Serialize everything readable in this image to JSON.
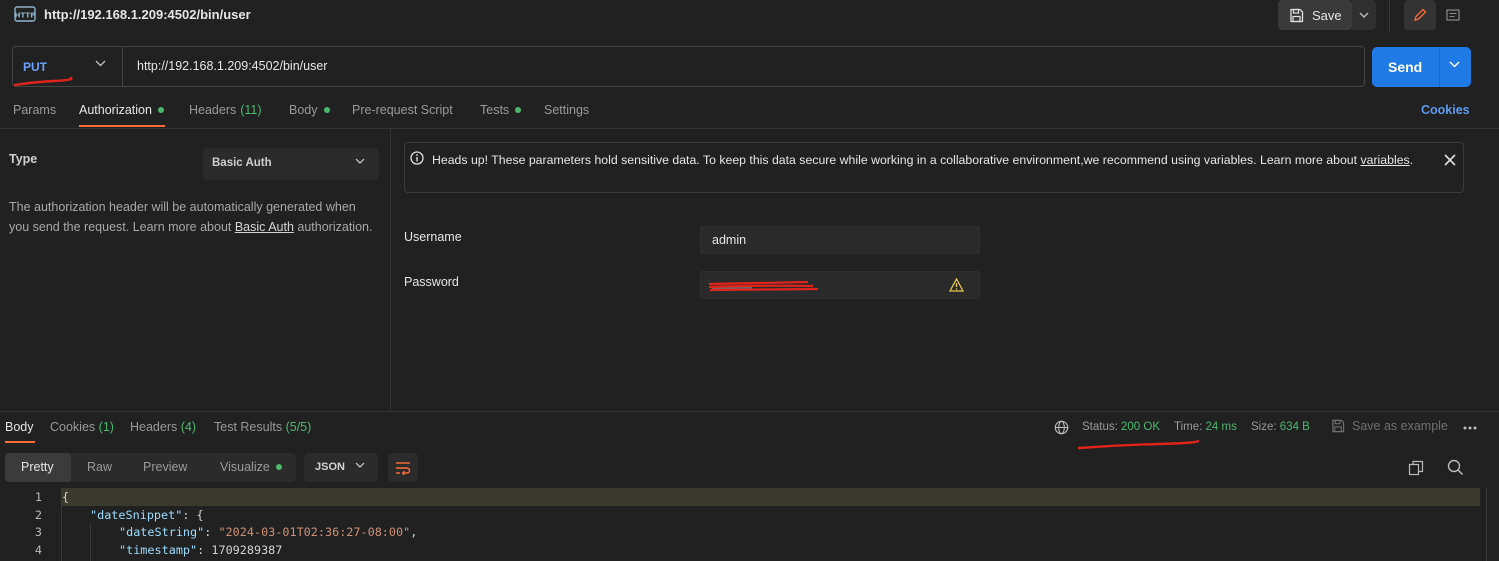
{
  "header": {
    "icon": "http-request-icon",
    "title": "http://192.168.1.209:4502/bin/user",
    "save_label": "Save"
  },
  "request": {
    "method": "PUT",
    "url": "http://192.168.1.209:4502/bin/user",
    "send_label": "Send"
  },
  "tabs": {
    "params": "Params",
    "authorization": "Authorization",
    "headers": "Headers",
    "headers_count": "(11)",
    "body": "Body",
    "pre_request": "Pre-request Script",
    "tests": "Tests",
    "settings": "Settings",
    "cookies": "Cookies"
  },
  "auth": {
    "type_label": "Type",
    "type_value": "Basic Auth",
    "desc_before": "The authorization header will be automatically generated when you send the request. Learn more about ",
    "desc_link": "Basic Auth",
    "desc_after": " authorization.",
    "banner_text": "Heads up! These parameters hold sensitive data. To keep this data secure while working in a collaborative environment,we recommend using variables. Learn more about ",
    "banner_link": "variables",
    "banner_after": ".",
    "username_label": "Username",
    "username_value": "admin",
    "password_label": "Password"
  },
  "response": {
    "tabs": {
      "body": "Body",
      "cookies": "Cookies",
      "cookies_count": "(1)",
      "headers": "Headers",
      "headers_count": "(4)",
      "tests": "Test Results",
      "tests_count": "(5/5)"
    },
    "status_label": "Status:",
    "status_value": "200 OK",
    "time_label": "Time:",
    "time_value": "24 ms",
    "size_label": "Size:",
    "size_value": "634 B",
    "save_example": "Save as example",
    "views": {
      "pretty": "Pretty",
      "raw": "Raw",
      "preview": "Preview",
      "visualize": "Visualize"
    },
    "format": "JSON",
    "code": {
      "line_numbers": [
        "1",
        "2",
        "3",
        "4"
      ],
      "l1": "{",
      "l2_key": "\"dateSnippet\"",
      "l2_rest": ": {",
      "l3_key": "\"dateString\"",
      "l3_sep": ": ",
      "l3_val": "\"2024-03-01T02:36:27-08:00\"",
      "l3_end": ",",
      "l4_key": "\"timestamp\"",
      "l4_sep": ": ",
      "l4_val": "1709289387"
    }
  },
  "colors": {
    "accent": "#ff6c37",
    "primary": "#1f7ae6",
    "success": "#4cb86f",
    "method_put": "#6ba3ff",
    "annotation_red": "#e0231b"
  }
}
